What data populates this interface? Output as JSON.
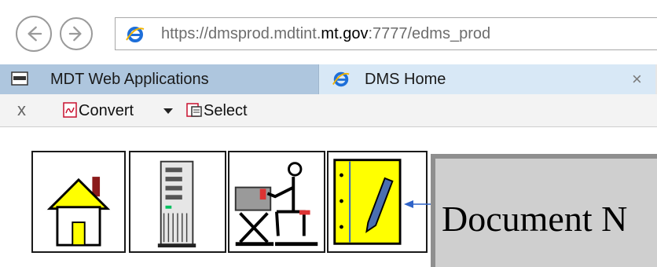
{
  "browser": {
    "url_prefix": "https://dmsprod.mdtint.",
    "url_domain": "mt.gov",
    "url_suffix": ":7777/edms_prod",
    "tabs": [
      {
        "label": "MDT Web Applications",
        "icon": "mdt-favicon-icon",
        "active": false
      },
      {
        "label": "DMS Home",
        "icon": "ie-icon",
        "active": true,
        "close": "×"
      }
    ],
    "accent": "#1e6fd9"
  },
  "toolbar": {
    "close": "x",
    "convert_label": "Convert",
    "select_label": "Select"
  },
  "page": {
    "icons": [
      "home-icon",
      "server-icon",
      "workstation-user-icon",
      "notes-pencil-icon"
    ],
    "title": "Document N",
    "colors": {
      "notes_bg": "#ffff00",
      "home_roof": "#ffff00",
      "panel_bg": "#cfcfcf",
      "arrow": "#2f63c8"
    }
  }
}
